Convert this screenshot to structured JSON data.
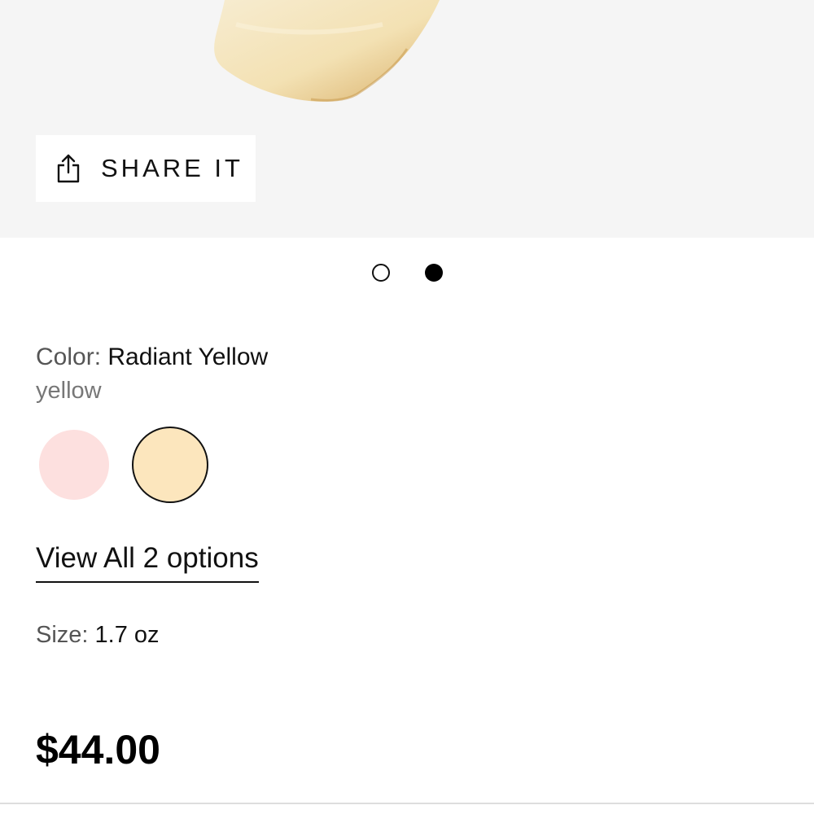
{
  "share": {
    "label": "SHARE IT",
    "icon": "share-icon"
  },
  "carousel": {
    "total_slides": 2,
    "active_slide": 2
  },
  "color": {
    "label": "Color:",
    "value": "Radiant Yellow",
    "family": "yellow",
    "swatches": [
      {
        "name": "pink",
        "hex": "#fde0df",
        "selected": false
      },
      {
        "name": "Radiant Yellow",
        "hex": "#fce6bd",
        "selected": true
      }
    ]
  },
  "options_link": "View All 2 options",
  "size": {
    "label": "Size:",
    "value": "1.7 oz"
  },
  "price": "$44.00",
  "colors": {
    "hero_background": "#f5f5f5",
    "product_cream": "#f3dfae"
  }
}
